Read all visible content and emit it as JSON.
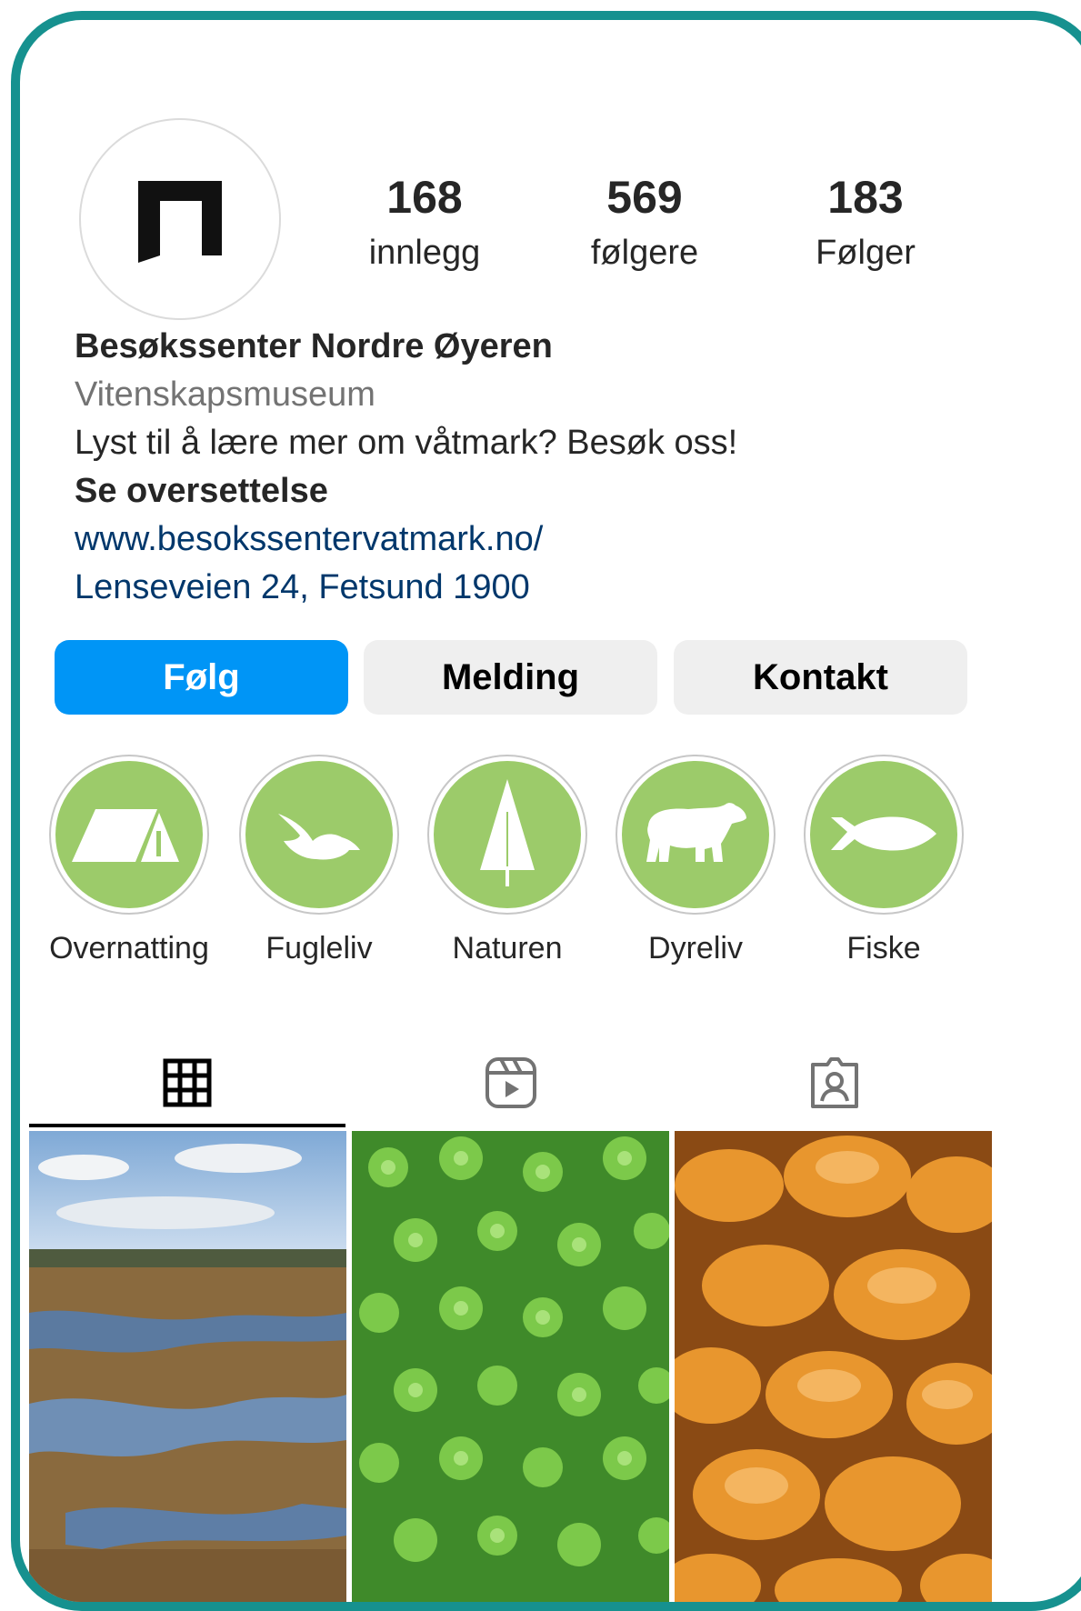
{
  "profile": {
    "avatar_icon": "museum-logo-icon",
    "stats": [
      {
        "value": "168",
        "label": "innlegg"
      },
      {
        "value": "569",
        "label": "følgere"
      },
      {
        "value": "183",
        "label": "Følger"
      }
    ],
    "name": "Besøkssenter Nordre Øyeren",
    "category": "Vitenskapsmuseum",
    "description": "Lyst til å lære mer om våtmark? Besøk oss!",
    "translate_label": "Se oversettelse",
    "website": "www.besokssentervatmark.no/",
    "address": "Lenseveien 24, Fetsund 1900"
  },
  "actions": {
    "follow": "Følg",
    "message": "Melding",
    "contact": "Kontakt"
  },
  "highlights": [
    {
      "label": "Overnatting",
      "icon": "tent-icon"
    },
    {
      "label": "Fugleliv",
      "icon": "bird-icon"
    },
    {
      "label": "Naturen",
      "icon": "tree-icon"
    },
    {
      "label": "Dyreliv",
      "icon": "bear-icon"
    },
    {
      "label": "Fiske",
      "icon": "fish-icon"
    }
  ],
  "tabs": [
    {
      "name": "posts",
      "icon": "grid-icon",
      "active": true
    },
    {
      "name": "reels",
      "icon": "reels-icon",
      "active": false
    },
    {
      "name": "tagged",
      "icon": "tagged-user-icon",
      "active": false
    }
  ],
  "colors": {
    "frame": "#16918f",
    "follow_button": "#0095f6",
    "highlight_fill": "#9ccb6a",
    "link": "#00376b"
  }
}
